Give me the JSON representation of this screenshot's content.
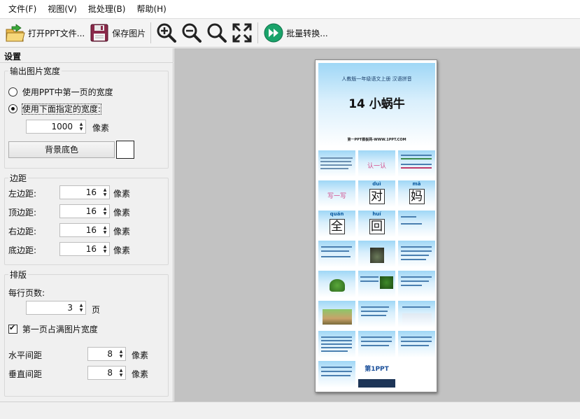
{
  "menu": [
    "文件(F)",
    "视图(V)",
    "批处理(B)",
    "帮助(H)"
  ],
  "toolbar": {
    "open_label": "打开PPT文件...",
    "save_label": "保存图片",
    "batch_label": "批量转换..."
  },
  "panel": {
    "title": "设置",
    "width_group": {
      "title": "输出图片宽度",
      "option_first": "使用PPT中第一页的宽度",
      "option_custom": "使用下面指定的宽度:",
      "width_value": "1000",
      "width_unit": "像素",
      "bg_button": "背景底色",
      "bg_color": "#ffffff"
    },
    "margin_group": {
      "title": "边距",
      "rows": [
        {
          "label": "左边距:",
          "value": "16",
          "unit": "像素"
        },
        {
          "label": "顶边距:",
          "value": "16",
          "unit": "像素"
        },
        {
          "label": "右边距:",
          "value": "16",
          "unit": "像素"
        },
        {
          "label": "底边距:",
          "value": "16",
          "unit": "像素"
        }
      ]
    },
    "layout_group": {
      "title": "排版",
      "per_row_label": "每行页数:",
      "per_row_value": "3",
      "per_row_unit": "页",
      "first_full_label": "第一页占满图片宽度",
      "h_gap_label": "水平间距",
      "h_gap_value": "8",
      "v_gap_label": "垂直间距",
      "v_gap_value": "8",
      "gap_unit": "像素"
    }
  },
  "preview": {
    "cover_header": "人教版一年级语文上册  汉语拼音",
    "cover_title": "14 小蜗牛",
    "cover_footer": "第一PPT模板网-WWW.1PPT.COM",
    "renshi": "认一认",
    "xieyixie": "写一写",
    "chars": [
      {
        "pinyin": "duì",
        "char": "对"
      },
      {
        "pinyin": "mā",
        "char": "妈"
      },
      {
        "pinyin": "quán",
        "char": "全"
      },
      {
        "pinyin": "huí",
        "char": "回"
      }
    ],
    "logo_text": "第1PPT"
  }
}
